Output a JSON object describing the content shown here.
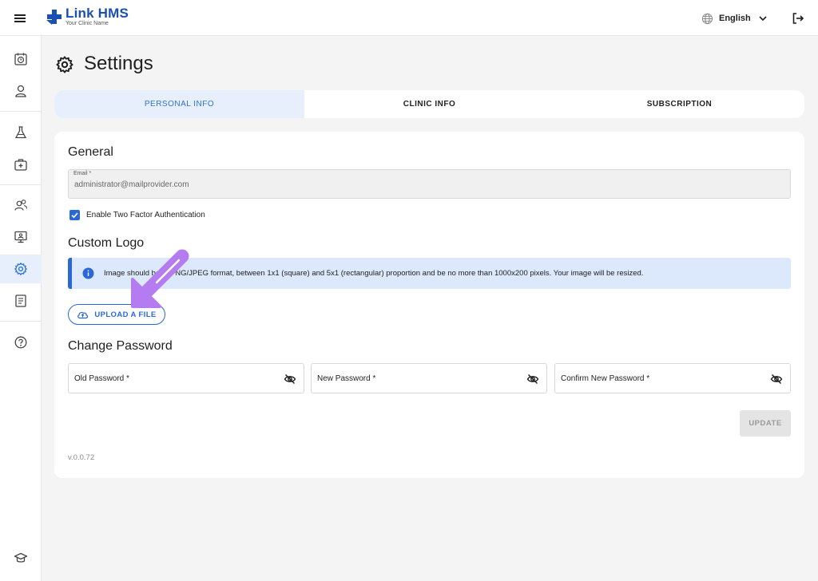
{
  "header": {
    "app_name": "Link HMS",
    "app_subtitle": "Your Clinic Name",
    "language": "English"
  },
  "page": {
    "title": "Settings"
  },
  "tabs": [
    {
      "label": "PERSONAL INFO",
      "active": true
    },
    {
      "label": "CLINIC INFO",
      "active": false
    },
    {
      "label": "SUBSCRIPTION",
      "active": false
    }
  ],
  "general": {
    "heading": "General",
    "email_label": "Email *",
    "email_value": "administrator@mailprovider.com",
    "two_factor_label": "Enable Two Factor Authentication",
    "two_factor_checked": true
  },
  "logo": {
    "heading": "Custom Logo",
    "info_text": "Image should be in PNG/JPEG format, between 1x1 (square) and 5x1 (rectangular) proportion and be no more than 1000x200 pixels. Your image will be resized.",
    "upload_label": "UPLOAD A FILE"
  },
  "password": {
    "heading": "Change Password",
    "old_label": "Old Password *",
    "new_label": "New Password *",
    "confirm_label": "Confirm New Password *",
    "update_label": "UPDATE"
  },
  "version": "v.0.0.72",
  "colors": {
    "accent": "#2a68d8",
    "active_tab_bg": "#e6effb",
    "info_bg": "#dce8fb",
    "overlay_arrow": "#b57bf0"
  }
}
